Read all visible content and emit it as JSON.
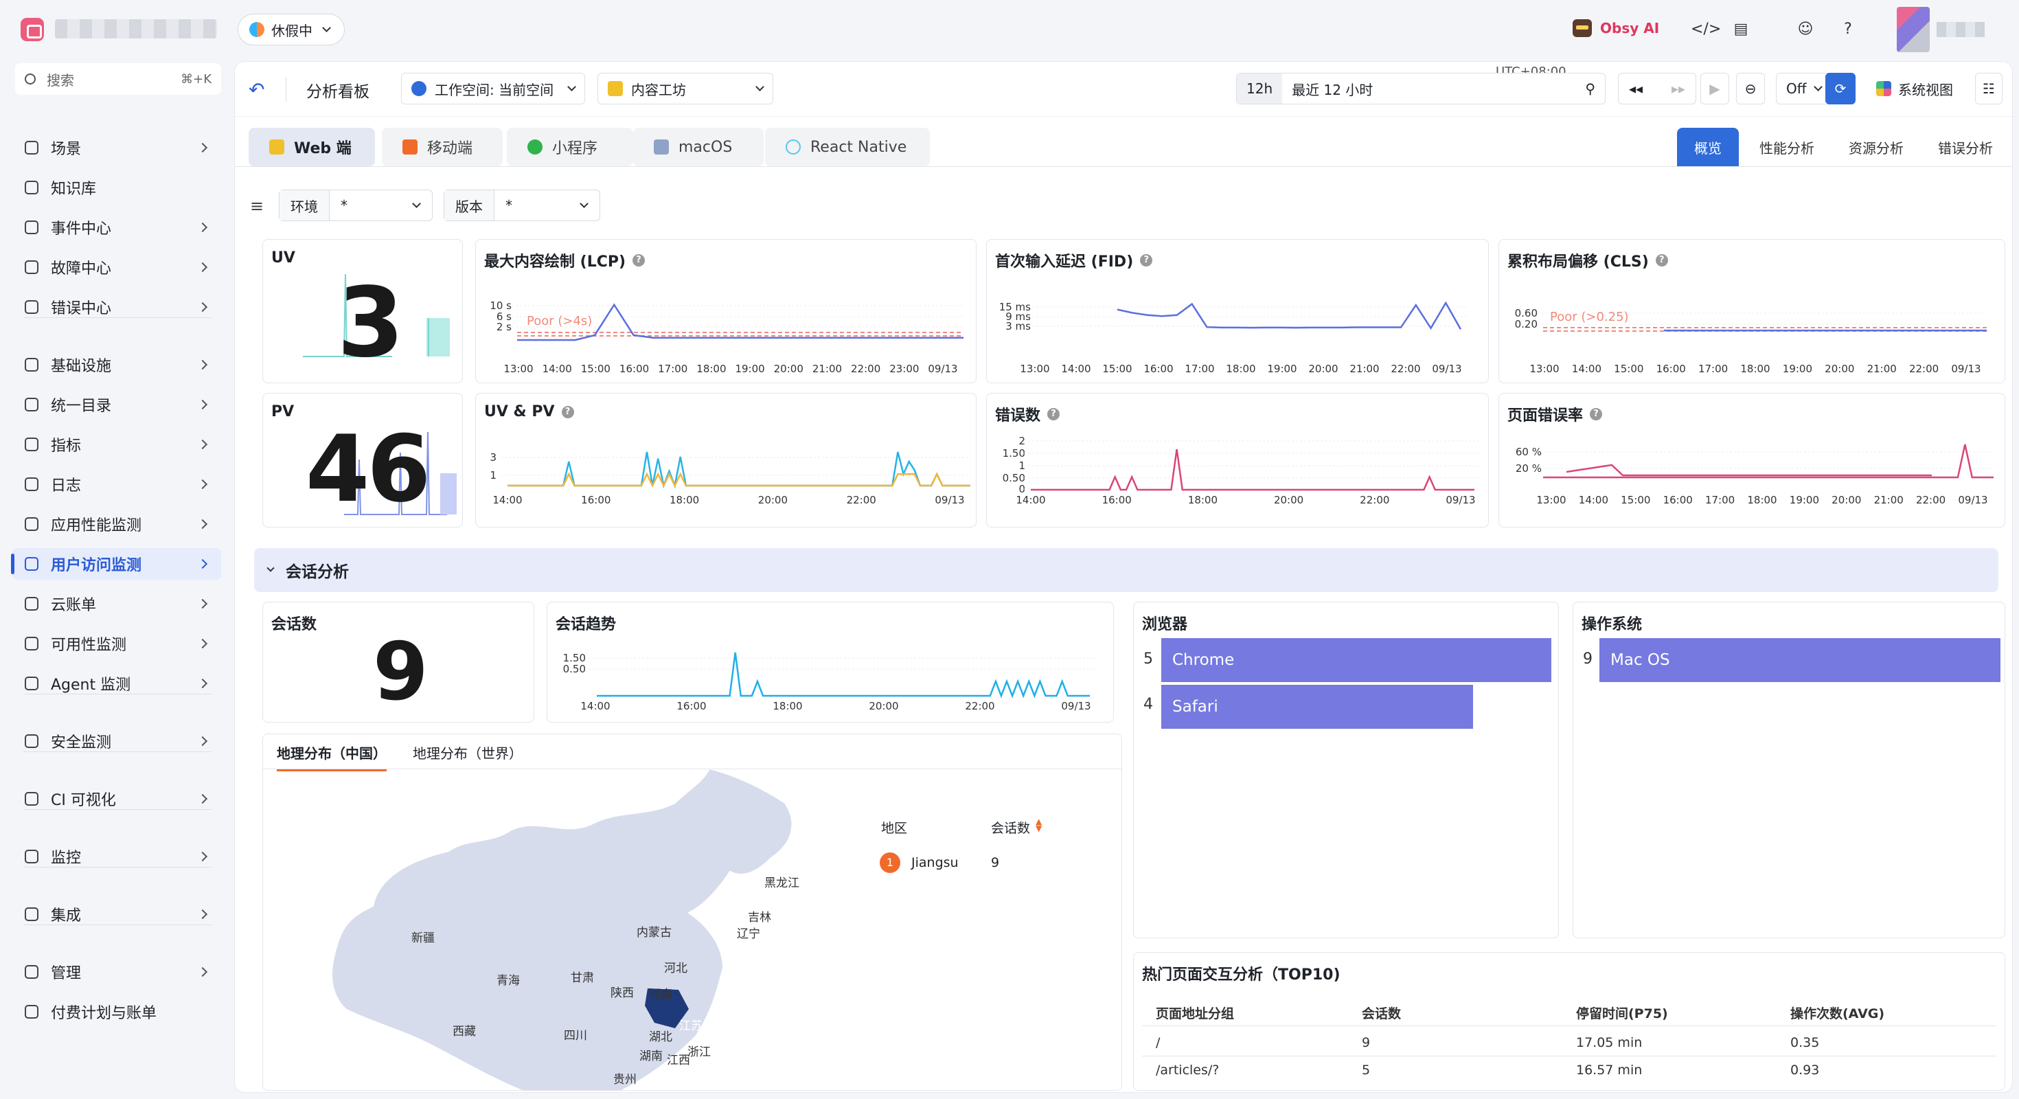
{
  "topbar": {
    "vacation_label": "休假中",
    "obsy_label": "Obsy AI"
  },
  "sidebar": {
    "search_placeholder": "搜索",
    "search_shortcut": "⌘+K",
    "items": [
      {
        "label": "场景",
        "chevron": true
      },
      {
        "label": "知识库",
        "chevron": false
      },
      {
        "label": "事件中心",
        "chevron": true
      },
      {
        "label": "故障中心",
        "chevron": true
      },
      {
        "label": "错误中心",
        "chevron": true
      },
      {
        "label": "基础设施",
        "chevron": true
      },
      {
        "label": "统一目录",
        "chevron": true
      },
      {
        "label": "指标",
        "chevron": true
      },
      {
        "label": "日志",
        "chevron": true
      },
      {
        "label": "应用性能监测",
        "chevron": true
      },
      {
        "label": "用户访问监测",
        "chevron": true,
        "active": true
      },
      {
        "label": "云账单",
        "chevron": true
      },
      {
        "label": "可用性监测",
        "chevron": true
      },
      {
        "label": "Agent 监测",
        "chevron": true
      },
      {
        "label": "安全监测",
        "chevron": true
      },
      {
        "label": "CI 可视化",
        "chevron": true
      },
      {
        "label": "监控",
        "chevron": true
      },
      {
        "label": "集成",
        "chevron": true
      },
      {
        "label": "管理",
        "chevron": true
      },
      {
        "label": "付费计划与账单",
        "chevron": false
      }
    ]
  },
  "toolbar": {
    "title": "分析看板",
    "workspace": "工作空间: 当前空间",
    "app": "内容工坊",
    "time_short": "12h",
    "time_range": "最近 12 小时",
    "timezone": "UTC+08:00",
    "refresh": "Off",
    "view": "系统视图"
  },
  "platform_tabs": [
    "Web 端",
    "移动端",
    "小程序",
    "macOS",
    "React Native"
  ],
  "view_tabs": [
    "概览",
    "性能分析",
    "资源分析",
    "错误分析"
  ],
  "filters": [
    {
      "label": "环境",
      "value": "*"
    },
    {
      "label": "版本",
      "value": "*"
    }
  ],
  "uv": {
    "title": "UV",
    "value": "3"
  },
  "pv": {
    "title": "PV",
    "value": "46"
  },
  "lcp": {
    "title": "最大内容绘制 (LCP)",
    "threshold": "Poor (>4s)",
    "yticks": [
      "10 s",
      "6 s",
      "2 s"
    ],
    "xticks": [
      "13:00",
      "14:00",
      "15:00",
      "16:00",
      "17:00",
      "18:00",
      "19:00",
      "20:00",
      "21:00",
      "22:00",
      "23:00",
      "09/13"
    ]
  },
  "fid": {
    "title": "首次输入延迟 (FID)",
    "yticks": [
      "15 ms",
      "9 ms",
      "3 ms"
    ],
    "xticks": [
      "13:00",
      "14:00",
      "15:00",
      "16:00",
      "17:00",
      "18:00",
      "19:00",
      "20:00",
      "21:00",
      "22:00",
      "09/13"
    ]
  },
  "cls": {
    "title": "累积布局偏移 (CLS)",
    "threshold": "Poor (>0.25)",
    "yticks": [
      "0.60",
      "0.20"
    ],
    "xticks": [
      "13:00",
      "14:00",
      "15:00",
      "16:00",
      "17:00",
      "18:00",
      "19:00",
      "20:00",
      "21:00",
      "22:00",
      "09/13"
    ]
  },
  "uvpv": {
    "title": "UV & PV",
    "yticks": [
      "3",
      "1"
    ],
    "xticks": [
      "14:00",
      "16:00",
      "18:00",
      "20:00",
      "22:00",
      "09/13"
    ]
  },
  "errors": {
    "title": "错误数",
    "yticks": [
      "2",
      "1.50",
      "1",
      "0.50",
      "0"
    ],
    "xticks": [
      "14:00",
      "16:00",
      "18:00",
      "20:00",
      "22:00",
      "09/13"
    ]
  },
  "error_rate": {
    "title": "页面错误率",
    "yticks": [
      "60 %",
      "20 %"
    ],
    "xticks": [
      "13:00",
      "14:00",
      "15:00",
      "16:00",
      "17:00",
      "18:00",
      "19:00",
      "20:00",
      "21:00",
      "22:00",
      "09/13"
    ]
  },
  "session_section": {
    "title": "会话分析"
  },
  "sessions": {
    "title": "会话数",
    "value": "9"
  },
  "session_trend": {
    "title": "会话趋势",
    "yticks": [
      "1.50",
      "0.50"
    ],
    "xticks": [
      "14:00",
      "16:00",
      "18:00",
      "20:00",
      "22:00",
      "09/13"
    ]
  },
  "browser": {
    "title": "浏览器",
    "rows": [
      {
        "count": "5",
        "name": "Chrome",
        "value": 5
      },
      {
        "count": "4",
        "name": "Safari",
        "value": 4
      }
    ]
  },
  "os": {
    "title": "操作系统",
    "rows": [
      {
        "count": "9",
        "name": "Mac OS",
        "value": 9
      }
    ]
  },
  "geo": {
    "tabs": [
      "地理分布（中国）",
      "地理分布（世界）"
    ],
    "col_region": "地区",
    "col_sessions": "会话数",
    "rows": [
      {
        "rank": "1",
        "region": "Jiangsu",
        "sessions": "9"
      }
    ],
    "provinces": [
      "黑龙江",
      "吉林",
      "辽宁",
      "内蒙古",
      "新疆",
      "河北",
      "青海",
      "甘肃",
      "陕西",
      "河南",
      "江苏",
      "西藏",
      "四川",
      "湖北",
      "浙江",
      "湖南",
      "江西",
      "贵州"
    ]
  },
  "top_pages": {
    "title": "热门页面交互分析（TOP10)",
    "headers": [
      "页面地址分组",
      "会话数",
      "停留时间(P75)",
      "操作次数(AVG)"
    ],
    "rows": [
      [
        "/",
        "9",
        "17.05 min",
        "0.35"
      ],
      [
        "/articles/?",
        "5",
        "16.57 min",
        "0.93"
      ]
    ]
  },
  "colors": {
    "accent": "#2f6bd9",
    "lcp_line": "#5b6ee1",
    "threshold": "#f08a7a",
    "uv_line": "#27b3e6",
    "pv_line": "#f3b43a",
    "error_line": "#d9457a",
    "session_line": "#1fb0e8",
    "bar": "#7579e0"
  },
  "chart_data": [
    {
      "type": "line",
      "title": "最大内容绘制 (LCP)",
      "series": [
        {
          "values": [
            0,
            0,
            0,
            0,
            1.3,
            9.5,
            1.3,
            0.6,
            0.6,
            0.6,
            0.6,
            0.6,
            0.6,
            0.6,
            0.6,
            0.6,
            0.6,
            0.6,
            0.6,
            0.6,
            0.6,
            0.6,
            0.6,
            0.6
          ]
        }
      ]
    },
    {
      "type": "line",
      "title": "首次输入延迟 (FID)",
      "series": [
        {
          "values": [
            12,
            10.5,
            9.5,
            9,
            9.5,
            14.5,
            4,
            3.8,
            3.8,
            3.7,
            3.8,
            3.8,
            3.7,
            3.8,
            3.8,
            3.8,
            3.9,
            3.9,
            3.9,
            3.9,
            14,
            3.5,
            15,
            3
          ]
        }
      ]
    },
    {
      "type": "line",
      "title": "累积布局偏移 (CLS)",
      "series": [
        {
          "values": [
            0.05,
            0.05,
            0.05,
            0.05,
            0.05,
            0.05,
            0.05,
            0.05,
            0.05,
            0.05,
            0.05,
            0.05,
            0.05,
            0.05,
            0.05,
            0.05,
            0.05,
            0.05,
            0.05,
            0.05,
            0.05,
            0.05,
            0.05,
            0.05
          ]
        }
      ]
    },
    {
      "type": "line",
      "title": "错误数",
      "series": [
        {
          "values": [
            0,
            0,
            0,
            0,
            0,
            0,
            0,
            0,
            0,
            0,
            0,
            0,
            0,
            0,
            0,
            0,
            0,
            0,
            0,
            0,
            0,
            0,
            0,
            0,
            0,
            0,
            0,
            0,
            0,
            0,
            0,
            0,
            0,
            0,
            0,
            0,
            0,
            0,
            0,
            0,
            0,
            0,
            0,
            0,
            0,
            0,
            0,
            0,
            0,
            0,
            0,
            0,
            0,
            0,
            0,
            0,
            0,
            0,
            0,
            0
          ]
        }
      ]
    },
    {
      "type": "line",
      "title": "会话趋势",
      "series": [
        {
          "values": [
            0,
            0,
            0,
            0,
            0,
            0,
            0,
            0,
            0,
            0,
            0,
            0,
            0,
            0,
            0,
            0,
            0,
            0,
            0,
            0,
            0,
            0,
            0,
            0,
            0,
            0,
            0,
            0,
            0,
            0,
            0,
            0,
            0,
            0,
            0,
            0,
            0,
            0,
            0,
            0,
            0,
            0,
            0,
            0,
            0,
            0,
            0,
            0,
            0,
            0,
            0,
            0,
            0,
            0,
            0,
            0,
            0,
            0,
            0,
            0
          ]
        }
      ]
    }
  ]
}
